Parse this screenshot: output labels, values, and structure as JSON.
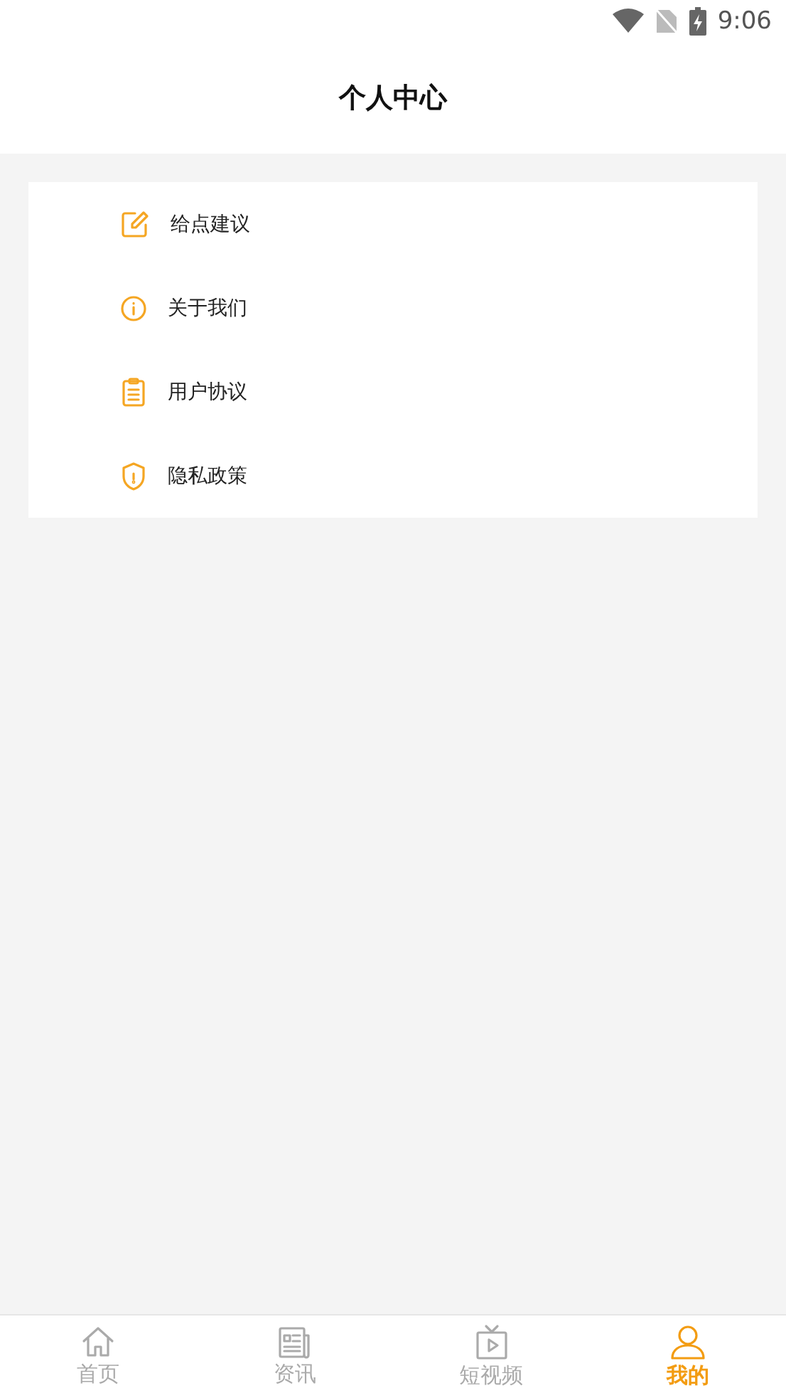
{
  "status_bar": {
    "time": "9:06"
  },
  "header": {
    "title": "个人中心"
  },
  "menu": [
    {
      "kind": "edit",
      "label": "给点建议"
    },
    {
      "kind": "info",
      "label": "关于我们"
    },
    {
      "kind": "clipboard",
      "label": "用户协议"
    },
    {
      "kind": "shield",
      "label": "隐私政策"
    }
  ],
  "tabs": [
    {
      "kind": "home",
      "label": "首页",
      "selected": false
    },
    {
      "kind": "news",
      "label": "资讯",
      "selected": false
    },
    {
      "kind": "video",
      "label": "短视频",
      "selected": false
    },
    {
      "kind": "user",
      "label": "我的",
      "selected": true
    }
  ]
}
